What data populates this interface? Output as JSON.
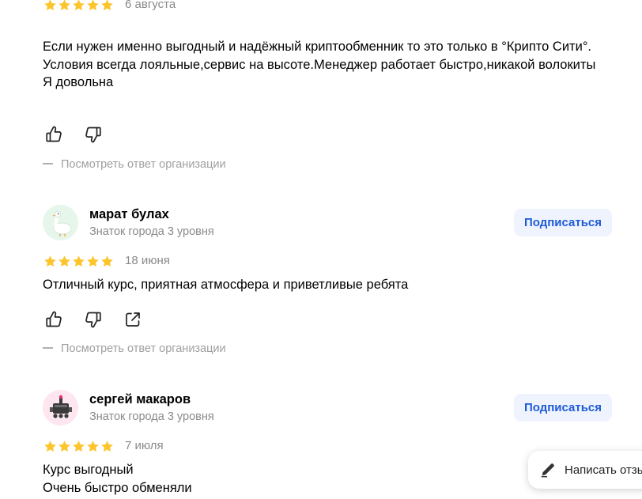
{
  "reviews": [
    {
      "rating": 5,
      "date": "6 августа",
      "text": "Если нужен именно выгодный и надёжный криптообменник то это только в °Крипто Сити°. Условия всегда лояльные,сервис на высоте.Менеджер работает быстро,никакой волокиты\nЯ довольна",
      "org_answer_label": "Посмотреть ответ организации"
    },
    {
      "author": "марат булах",
      "level": "Знаток города 3 уровня",
      "avatar_icon": "goose-avatar",
      "subscribe_label": "Подписаться",
      "rating": 5,
      "date": "18 июня",
      "text": "Отличный курс, приятная атмосфера и приветливые ребята",
      "org_answer_label": "Посмотреть ответ организации"
    },
    {
      "author": "сергей макаров",
      "level": "Знаток города 3 уровня",
      "avatar_icon": "robot-avatar",
      "subscribe_label": "Подписаться",
      "rating": 5,
      "date": "7 июля",
      "text": "Курс выгодный\nОчень быстро обменяли"
    }
  ],
  "write_review": {
    "label": "Написать отзыв",
    "icon": "pencil-icon"
  },
  "colors": {
    "star": "#fcc52c",
    "accent": "#1f5bd8",
    "subscribe_bg": "#eef3fd",
    "muted": "#8a8a8a"
  }
}
